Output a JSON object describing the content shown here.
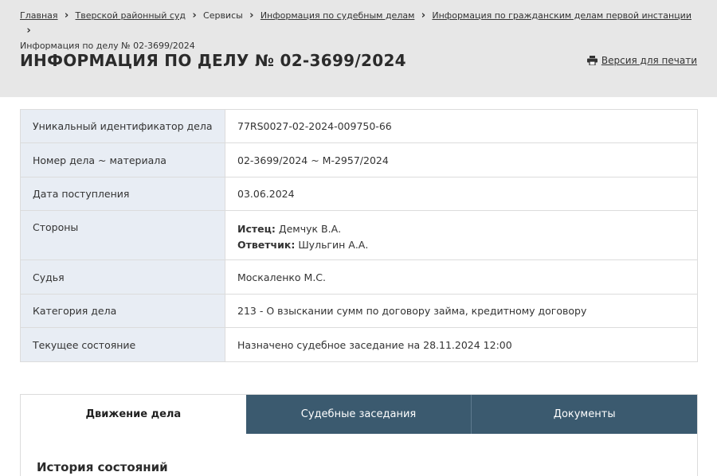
{
  "breadcrumb": {
    "items": [
      {
        "label": "Главная",
        "link": true
      },
      {
        "label": "Тверской районный суд",
        "link": true
      },
      {
        "label": "Сервисы",
        "link": false
      },
      {
        "label": "Информация по судебным делам",
        "link": true
      },
      {
        "label": "Информация по гражданским делам первой инстанции",
        "link": true
      }
    ],
    "current": "Информация по делу № 02-3699/2024"
  },
  "header": {
    "title": "Информация по делу № 02-3699/2024",
    "print_label": "Версия для печати"
  },
  "case_info": {
    "uid_label": "Уникальный идентификатор дела",
    "uid_value": "77RS0027-02-2024-009750-66",
    "number_label": "Номер дела ~ материала",
    "number_value": "02-3699/2024 ~ М-2957/2024",
    "date_label": "Дата поступления",
    "date_value": "03.06.2024",
    "parties_label": "Стороны",
    "plaintiff_label": "Истец:",
    "plaintiff_value": "Демчук В.А.",
    "defendant_label": "Ответчик:",
    "defendant_value": "Шульгин А.А.",
    "judge_label": "Судья",
    "judge_value": "Москаленко М.С.",
    "category_label": "Категория дела",
    "category_value": "213 - О взыскании сумм по договору займа, кредитному договору",
    "status_label": "Текущее состояние",
    "status_value": "Назначено судебное заседание на 28.11.2024 12:00"
  },
  "tabs": [
    {
      "label": "Движение дела",
      "active": true
    },
    {
      "label": "Судебные заседания",
      "active": false
    },
    {
      "label": "Документы",
      "active": false
    }
  ],
  "section": {
    "heading": "История состояний"
  },
  "colors": {
    "header_bg": "#e7e7e7",
    "label_bg": "#e8edf4",
    "tab_inactive_bg": "#3b5a6f"
  },
  "icons": {
    "print": "printer-icon"
  }
}
